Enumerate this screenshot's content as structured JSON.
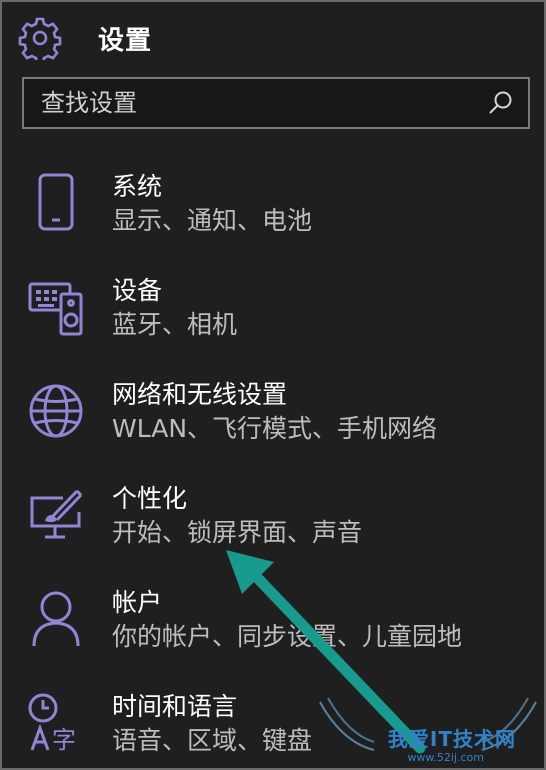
{
  "header": {
    "title": "设置",
    "icon": "gear-icon"
  },
  "search": {
    "placeholder": "查找设置",
    "icon": "search-icon"
  },
  "colors": {
    "accent": "#8f86d6",
    "background": "#1f1f1f",
    "arrow": "#189a8f"
  },
  "items": [
    {
      "title": "系统",
      "subtitle": "显示、通知、电池",
      "icon": "phone-icon"
    },
    {
      "title": "设备",
      "subtitle": "蓝牙、相机",
      "icon": "devices-icon"
    },
    {
      "title": "网络和无线设置",
      "subtitle": "WLAN、飞行模式、手机网络",
      "icon": "globe-icon"
    },
    {
      "title": "个性化",
      "subtitle": "开始、锁屏界面、声音",
      "icon": "personalization-icon"
    },
    {
      "title": "帐户",
      "subtitle": "你的帐户、同步设置、儿童园地",
      "icon": "person-icon"
    },
    {
      "title": "时间和语言",
      "subtitle": "语音、区域、键盘",
      "icon": "time-language-icon"
    }
  ],
  "watermark": {
    "text": "我爱IT技术网",
    "url": "www.52ij.com"
  }
}
